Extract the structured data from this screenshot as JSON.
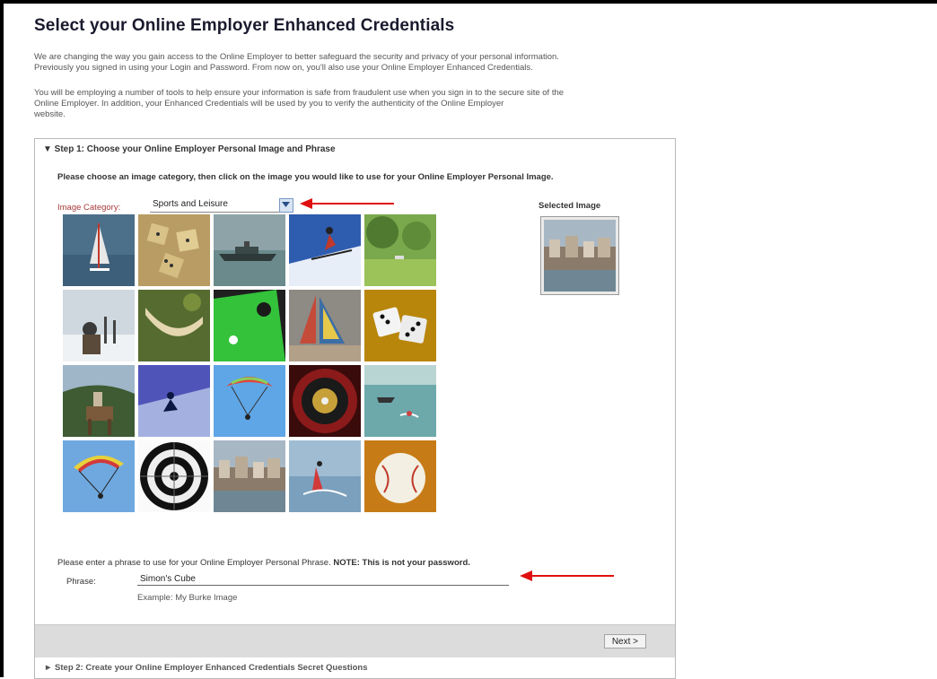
{
  "page": {
    "title": "Select your Online Employer Enhanced Credentials",
    "intro_1_line_1": "We are changing the way you gain access to the Online Employer to better safeguard the security and privacy of your personal information.",
    "intro_1_line_2": "Previously you signed in using your Login and Password. From now on, you'll also use your Online Employer Enhanced Credentials.",
    "intro_2_line_1": "You will be employing a number of tools to help ensure your information is safe from fraudulent use when you sign in to the secure site of the",
    "intro_2_line_2": "Online Employer. In addition, your Enhanced Credentials will be used by you to verify the authenticity of the Online Employer",
    "intro_2_line_3": "website."
  },
  "step1": {
    "header": "▼ Step 1: Choose your Online Employer Personal Image and Phrase",
    "instruction": "Please choose an image category, then click on the image you would like to use for your Online Employer Personal Image.",
    "category_label": "Image Category:",
    "category_value": "Sports and Leisure",
    "selected_image_label": "Selected Image",
    "images": [
      "windsurfer-image",
      "dice-image",
      "ship-image",
      "skier-image",
      "park-image",
      "skiers-resting-image",
      "hammock-image",
      "billiards-image",
      "sailboat-image",
      "white-dice-image",
      "horse-rider-image",
      "ski-slope-image",
      "paraglider-image",
      "roulette-image",
      "motorboat-image",
      "parachute-image",
      "dartboard-image",
      "harbour-town-image",
      "water-skier-image",
      "baseball-image"
    ]
  },
  "phrase": {
    "instruction_prefix": "Please enter a phrase to use for your Online Employer Personal Phrase.",
    "note": "NOTE: This is not your password.",
    "label": "Phrase:",
    "value": "Simon's Cube",
    "example": "Example: My Burke Image"
  },
  "buttons": {
    "next": "Next >"
  },
  "step2": {
    "header": "► Step 2: Create your Online Employer Enhanced Credentials Secret Questions"
  },
  "colors": {
    "arrow": "#e01010",
    "panel_border": "#b9b9b9",
    "footer_bar": "#dcdcdc"
  }
}
